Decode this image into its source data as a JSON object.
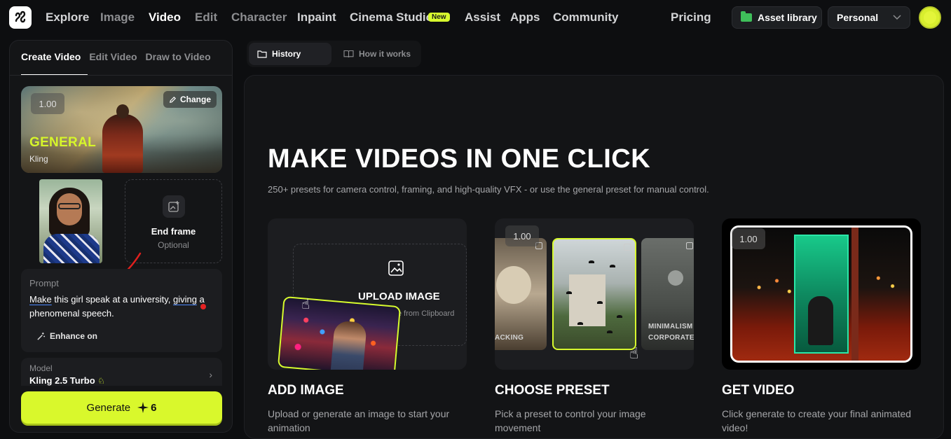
{
  "nav": {
    "items": [
      "Explore",
      "Image",
      "Video",
      "Edit",
      "Character",
      "Inpaint",
      "Cinema Studio",
      "Assist",
      "Apps",
      "Community"
    ],
    "new_badge": "New",
    "pricing": "Pricing",
    "asset_library": "Asset library",
    "workspace": "Personal"
  },
  "left_panel": {
    "tabs": [
      "Create Video",
      "Edit Video",
      "Draw to Video"
    ],
    "preset": {
      "value": "1.00",
      "change_label": "Change",
      "name": "GENERAL",
      "model": "Kling"
    },
    "end_frame": {
      "title": "End frame",
      "subtitle": "Optional"
    },
    "prompt": {
      "label": "Prompt",
      "word_make": "Make",
      "text_mid": " this girl speak at a university, ",
      "word_giving": "giving",
      "text_end": " a phenomenal speech.",
      "enhance_label": "Enhance on"
    },
    "model": {
      "label": "Model",
      "value": "Kling 2.5 Turbo"
    },
    "generate": {
      "label": "Generate",
      "cost": "6"
    }
  },
  "view_tabs": {
    "history": "History",
    "how_it_works": "How it works"
  },
  "hero": {
    "title": "MAKE VIDEOS IN ONE CLICK",
    "subtitle": "250+ presets for camera control, framing, and high-quality VFX - or use the general preset for manual control."
  },
  "steps": [
    {
      "title": "ADD IMAGE",
      "desc": "Upload or generate an image to start your animation",
      "upload_title": "UPLOAD IMAGE",
      "upload_sub": "Paste from Clipboard"
    },
    {
      "title": "CHOOSE PRESET",
      "desc": "Pick a preset to control your image movement",
      "value": "1.00",
      "thumb_labels": [
        "ACKING",
        "MINIMALISM",
        "CORPORATE"
      ]
    },
    {
      "title": "GET VIDEO",
      "desc": "Click generate to create your final animated video!",
      "value": "1.00"
    }
  ],
  "colors": {
    "accent": "#d7fb2e",
    "background": "#0d0e10",
    "panel": "#141517",
    "muted_text": "#8d8e91"
  }
}
